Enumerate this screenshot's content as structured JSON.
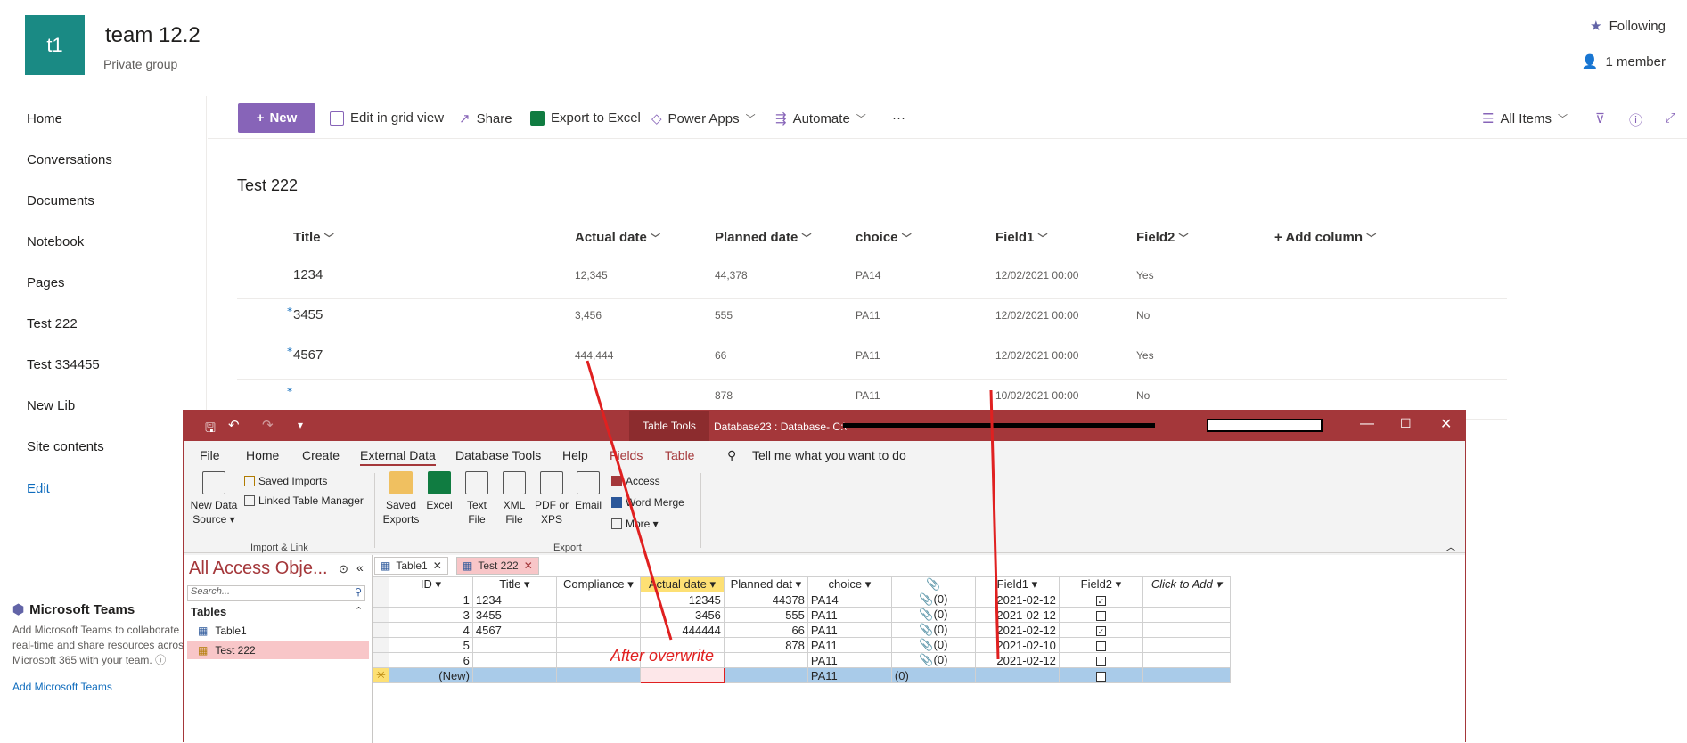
{
  "site": {
    "logo": "t1",
    "title": "team 12.2",
    "subtitle": "Private group",
    "following": "Following",
    "members": "1 member"
  },
  "nav": {
    "items": [
      "Home",
      "Conversations",
      "Documents",
      "Notebook",
      "Pages",
      "Test 222",
      "Test 334455",
      "New Lib",
      "Site contents"
    ],
    "edit": "Edit"
  },
  "teams": {
    "title": "Microsoft Teams",
    "desc": "Add Microsoft Teams to collaborate in real-time and share resources across Microsoft 365 with your team.",
    "info": "ⓘ",
    "link": "Add Microsoft Teams"
  },
  "commandbar": {
    "new": "New",
    "edit_grid": "Edit in grid view",
    "share": "Share",
    "export": "Export to Excel",
    "power_apps": "Power Apps",
    "automate": "Automate",
    "more": "···",
    "view": "All Items"
  },
  "list": {
    "title": "Test 222",
    "columns": [
      "Title",
      "Actual date",
      "Planned date",
      "choice",
      "Field1",
      "Field2",
      "+ Add column"
    ],
    "rows": [
      [
        "1234",
        "12,345",
        "44,378",
        "PA14",
        "12/02/2021 00:00",
        "Yes"
      ],
      [
        "3455",
        "3,456",
        "555",
        "PA11",
        "12/02/2021 00:00",
        "No"
      ],
      [
        "4567",
        "444,444",
        "66",
        "PA11",
        "12/02/2021 00:00",
        "Yes"
      ],
      [
        "",
        "",
        "878",
        "PA11",
        "10/02/2021 00:00",
        "No"
      ]
    ]
  },
  "access": {
    "titlebar": {
      "table_tools": "Table Tools",
      "caption": "Database23 : Database- C:\\"
    },
    "tabs": [
      "File",
      "Home",
      "Create",
      "External Data",
      "Database Tools",
      "Help",
      "Fields",
      "Table"
    ],
    "tell_me": "Tell me what you want to do",
    "ribbon": {
      "new_data_source": "New Data Source ▾",
      "saved_imports": "Saved Imports",
      "linked_table_manager": "Linked Table Manager",
      "import_group": "Import & Link",
      "saved_exports": "Saved Exports",
      "excel": "Excel",
      "text_file": "Text File",
      "xml_file": "XML File",
      "pdf_xps": "PDF or XPS",
      "email": "Email",
      "access": "Access",
      "word_merge": "Word Merge",
      "more": "More ▾",
      "export_group": "Export"
    },
    "navpane": {
      "title": "All Access Obje...",
      "search": "Search...",
      "tables": "Tables",
      "items": [
        "Table1",
        "Test 222"
      ]
    },
    "doc_tabs": [
      "Table1",
      "Test 222"
    ],
    "grid": {
      "headers": [
        "ID",
        "Title",
        "Compliance",
        "Actual date",
        "Planned dat",
        "choice",
        "📎",
        "Field1",
        "Field2",
        "Click to Add"
      ],
      "rows": [
        {
          "id": "1",
          "title": "1234",
          "compliance": "",
          "actual": "12345",
          "planned": "44378",
          "choice": "PA14",
          "att": "(0)",
          "field1": "2021-02-12",
          "field2": true
        },
        {
          "id": "3",
          "title": "3455",
          "compliance": "",
          "actual": "3456",
          "planned": "555",
          "choice": "PA11",
          "att": "(0)",
          "field1": "2021-02-12",
          "field2": false
        },
        {
          "id": "4",
          "title": "4567",
          "compliance": "",
          "actual": "444444",
          "planned": "66",
          "choice": "PA11",
          "att": "(0)",
          "field1": "2021-02-12",
          "field2": true
        },
        {
          "id": "5",
          "title": "",
          "compliance": "",
          "actual": "",
          "planned": "878",
          "choice": "PA11",
          "att": "(0)",
          "field1": "2021-02-10",
          "field2": false
        },
        {
          "id": "6",
          "title": "",
          "compliance": "",
          "actual": "",
          "planned": "",
          "choice": "PA11",
          "att": "(0)",
          "field1": "2021-02-12",
          "field2": false
        }
      ],
      "new_row": {
        "id": "(New)",
        "choice": "PA11",
        "att": "(0)"
      }
    },
    "annotation": "After overwrite"
  }
}
